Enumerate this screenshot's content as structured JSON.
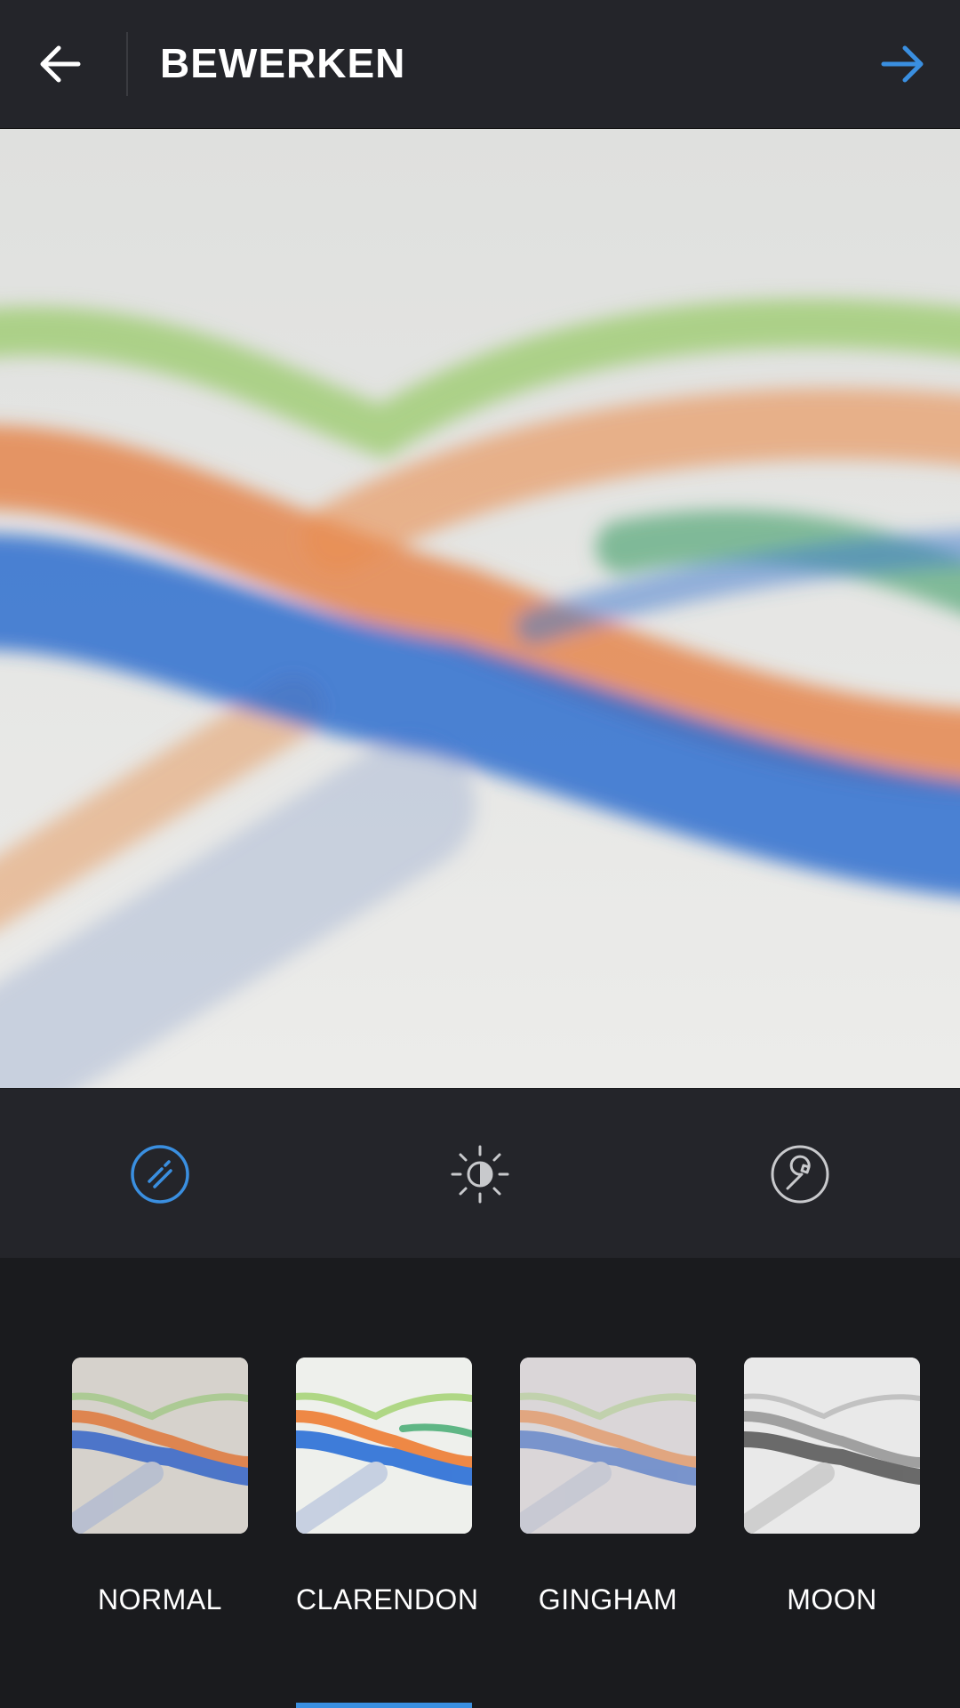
{
  "header": {
    "title": "BEWERKEN",
    "back_icon": "arrow-left-icon",
    "next_icon": "arrow-right-icon",
    "accent_color": "#3a8fe0"
  },
  "tools": [
    {
      "name": "filter",
      "icon": "filter-wand-icon",
      "active": true
    },
    {
      "name": "adjust",
      "icon": "brightness-icon",
      "active": false
    },
    {
      "name": "edit",
      "icon": "wrench-icon",
      "active": false
    }
  ],
  "filters": [
    {
      "label": "NORMAL",
      "selected": false
    },
    {
      "label": "CLARENDON",
      "selected": true
    },
    {
      "label": "GINGHAM",
      "selected": false
    },
    {
      "label": "MOON",
      "selected": false
    }
  ]
}
